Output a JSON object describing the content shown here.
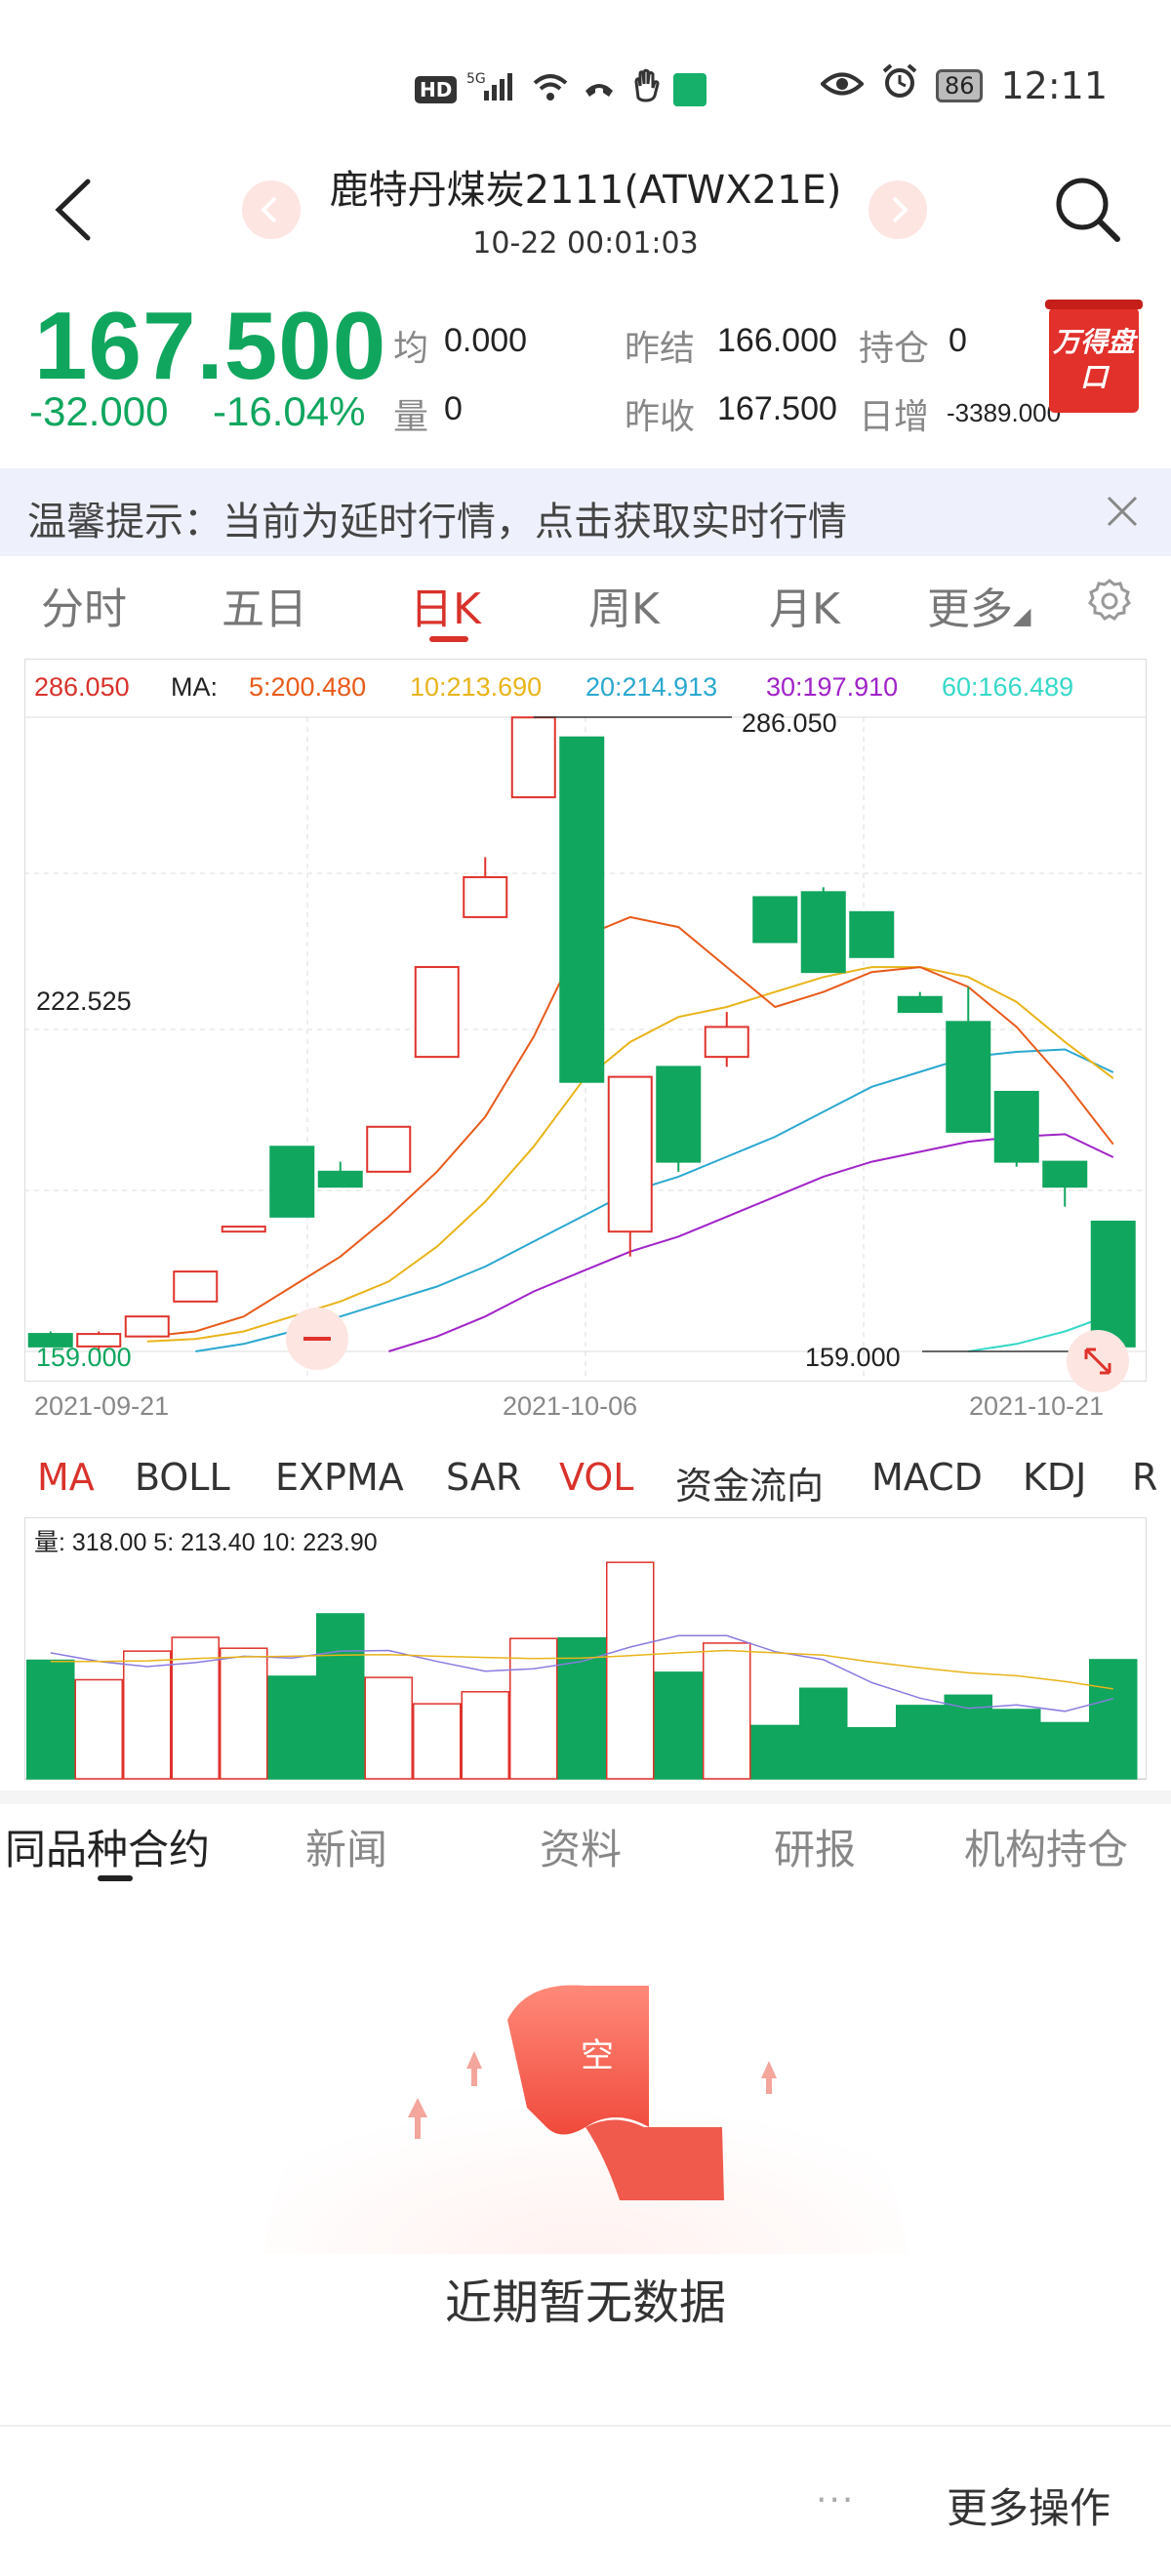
{
  "status_bar": {
    "hd": "HD",
    "net": "5G",
    "battery": "86",
    "time": "12:11"
  },
  "header": {
    "title": "鹿特丹煤炭2111(ATWX21E)",
    "subtitle": "10-22 00:01:03",
    "prev_icon": "chevron-left-icon",
    "next_icon": "chevron-right-icon"
  },
  "quote": {
    "price": "167.500",
    "change": "-32.000",
    "change_pct": "-16.04%",
    "avg_label": "均",
    "avg_value": "0.000",
    "volume_label": "量",
    "volume_value": "0",
    "prev_settle_label": "昨结",
    "prev_settle_value": "166.000",
    "open_interest_label": "持仓",
    "open_interest_value": "0",
    "prev_close_label": "昨收",
    "prev_close_value": "167.500",
    "daily_increase_label": "日增",
    "daily_increase_value": "-3389.000",
    "wind_button": "万得盘口",
    "up_color": "#e0322b",
    "down_color": "#10a65e"
  },
  "notice": {
    "text": "温馨提示：当前为延时行情，点击获取实时行情"
  },
  "tabs": [
    "分时",
    "五日",
    "日K",
    "周K",
    "月K",
    "更多"
  ],
  "active_tab": "日K",
  "chart_data": {
    "type": "candlestick",
    "ma_header": {
      "price": "286.050",
      "label": "MA:",
      "ma5": "5:200.480",
      "ma10": "10:213.690",
      "ma20": "20:214.913",
      "ma30": "30:197.910",
      "ma60": "60:166.489"
    },
    "ma_colors": {
      "ma5": "#e85a1a",
      "ma10": "#e8b41a",
      "ma20": "#2aa8d0",
      "ma30": "#a023c8",
      "ma60": "#36d8c8"
    },
    "y_labels": {
      "max": "286.050",
      "mid": "222.525",
      "min": "159.000"
    },
    "high_marker": "286.050",
    "low_marker": "159.000",
    "x_labels": [
      "2021-09-21",
      "2021-10-06",
      "2021-10-21"
    ],
    "ylim": [
      159.0,
      286.05
    ],
    "candles": [
      {
        "o": 162.5,
        "c": 160.0,
        "h": 163.0,
        "l": 160.0
      },
      {
        "o": 160.0,
        "c": 162.5,
        "h": 163.0,
        "l": 159.0
      },
      {
        "o": 162.0,
        "c": 166.0,
        "h": 166.0,
        "l": 162.0
      },
      {
        "o": 169.0,
        "c": 175.0,
        "h": 175.0,
        "l": 169.0
      },
      {
        "o": 183.0,
        "c": 184.0,
        "h": 184.0,
        "l": 183.0
      },
      {
        "o": 200.0,
        "c": 186.0,
        "h": 200.0,
        "l": 186.0
      },
      {
        "o": 195.0,
        "c": 192.0,
        "h": 197.0,
        "l": 192.0
      },
      {
        "o": 195.0,
        "c": 204.0,
        "h": 204.0,
        "l": 195.0
      },
      {
        "o": 218.0,
        "c": 236.0,
        "h": 236.0,
        "l": 218.0
      },
      {
        "o": 246.0,
        "c": 254.0,
        "h": 258.0,
        "l": 246.0
      },
      {
        "o": 270.0,
        "c": 286.0,
        "h": 286.05,
        "l": 270.0
      },
      {
        "o": 282.0,
        "c": 213.0,
        "h": 282.0,
        "l": 213.0
      },
      {
        "o": 183.0,
        "c": 214.0,
        "h": 214.0,
        "l": 178.0
      },
      {
        "o": 216.0,
        "c": 197.0,
        "h": 216.0,
        "l": 195.0
      },
      {
        "o": 218.0,
        "c": 224.0,
        "h": 227.0,
        "l": 216.0
      },
      {
        "o": 250.0,
        "c": 241.0,
        "h": 250.0,
        "l": 241.0
      },
      {
        "o": 251.0,
        "c": 235.0,
        "h": 252.0,
        "l": 235.0
      },
      {
        "o": 247.0,
        "c": 238.0,
        "h": 247.0,
        "l": 238.0
      },
      {
        "o": 230.0,
        "c": 227.0,
        "h": 231.0,
        "l": 227.0
      },
      {
        "o": 225.0,
        "c": 203.0,
        "h": 232.0,
        "l": 203.0
      },
      {
        "o": 211.0,
        "c": 197.0,
        "h": 211.0,
        "l": 196.0
      },
      {
        "o": 197.0,
        "c": 192.0,
        "h": 197.0,
        "l": 188.0
      },
      {
        "o": 185.0,
        "c": 160.0,
        "h": 185.0,
        "l": 159.0
      }
    ],
    "ma5": [
      null,
      null,
      162.0,
      163.0,
      166.0,
      172.0,
      178.0,
      186.0,
      195.0,
      206.0,
      222.0,
      242.0,
      246.0,
      244.0,
      236.0,
      228.0,
      231.0,
      235.0,
      236.0,
      232.0,
      224.0,
      213.0,
      200.5
    ],
    "ma10": [
      null,
      null,
      161.0,
      161.5,
      163.0,
      166.0,
      169.0,
      173.0,
      180.0,
      189.0,
      200.0,
      213.0,
      221.0,
      226.0,
      228.0,
      231.0,
      234.0,
      236.0,
      236.0,
      234.0,
      229.0,
      221.0,
      213.7
    ],
    "ma20": [
      null,
      null,
      null,
      159.0,
      160.5,
      163.0,
      166.0,
      169.0,
      172.0,
      176.0,
      181.0,
      186.0,
      191.0,
      194.0,
      198.0,
      202.0,
      207.0,
      212.0,
      215.0,
      218.0,
      219.0,
      219.5,
      214.9
    ],
    "ma30": [
      null,
      null,
      null,
      null,
      null,
      null,
      null,
      159.0,
      162.0,
      166.0,
      171.0,
      175.0,
      179.0,
      182.0,
      186.0,
      190.0,
      194.0,
      197.0,
      199.0,
      201.0,
      202.0,
      202.5,
      197.9
    ],
    "ma60": [
      null,
      null,
      null,
      null,
      null,
      null,
      null,
      null,
      null,
      null,
      null,
      null,
      null,
      null,
      null,
      null,
      null,
      null,
      null,
      159.0,
      160.5,
      163.0,
      166.5
    ]
  },
  "indicator_tabs": [
    "MA",
    "BOLL",
    "EXPMA",
    "SAR",
    "VOL",
    "资金流向",
    "MACD",
    "KDJ",
    "R"
  ],
  "active_indicators": [
    "MA",
    "VOL"
  ],
  "volume": {
    "label": "量: 318.00  5: 213.40  10: 223.90",
    "values": [
      207,
      173,
      223,
      247,
      228,
      179,
      288,
      177,
      131,
      152,
      245,
      246,
      378,
      186,
      237,
      93,
      158,
      89,
      128,
      146,
      121,
      98,
      208
    ],
    "ymax": 380,
    "ma5": [
      220,
      205,
      196,
      203,
      214,
      211,
      223,
      224,
      205,
      188,
      192,
      205,
      230,
      250,
      250,
      222,
      208,
      168,
      141,
      123,
      129,
      118,
      140
    ],
    "ma10": [
      205,
      205,
      206,
      210,
      213,
      214,
      216,
      217,
      214,
      212,
      210,
      211,
      215,
      220,
      224,
      220,
      216,
      204,
      194,
      185,
      180,
      170,
      157
    ]
  },
  "bottom_tabs": [
    "同品种合约",
    "新闻",
    "资料",
    "研报",
    "机构持仓"
  ],
  "active_bottom_tab": "同品种合约",
  "empty": {
    "badge": "空",
    "text": "近期暂无数据"
  },
  "bottom_bar": {
    "dots": "···",
    "more": "更多操作"
  }
}
